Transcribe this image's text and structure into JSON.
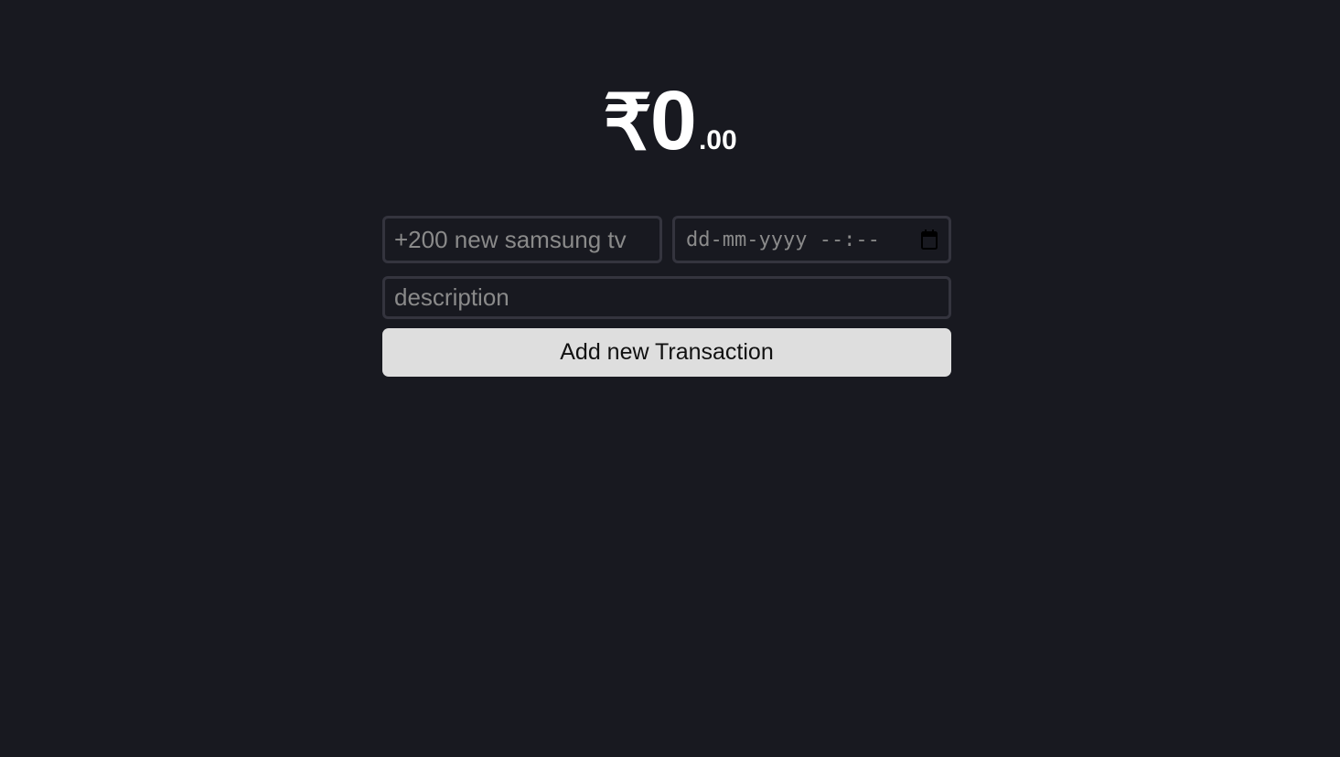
{
  "balance": {
    "currency": "₹",
    "integer": "0",
    "cents": ".00"
  },
  "form": {
    "name_placeholder": "+200 new samsung tv",
    "datetime_placeholder": "dd-mm-yyyy  --:--",
    "datetime_icon": "calendar-icon",
    "description_placeholder": "description",
    "submit_label": "Add new Transaction"
  },
  "colors": {
    "background": "#181920",
    "field_border": "#34343e",
    "button_bg": "#dedede",
    "text": "#ffffff"
  }
}
